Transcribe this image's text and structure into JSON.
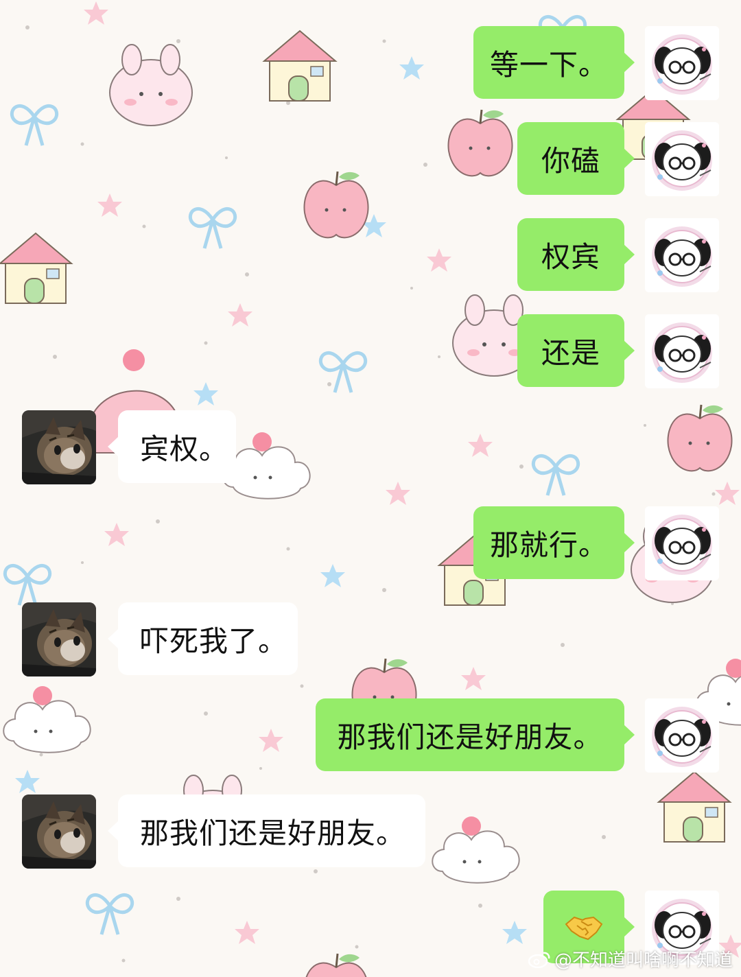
{
  "chat": {
    "messages": [
      {
        "side": "me",
        "text": "等一下。"
      },
      {
        "side": "me",
        "text": "你磕"
      },
      {
        "side": "me",
        "text": "权宾"
      },
      {
        "side": "me",
        "text": "还是"
      },
      {
        "side": "them",
        "text": "宾权。"
      },
      {
        "side": "me",
        "text": "那就行。"
      },
      {
        "side": "them",
        "text": "吓死我了。"
      },
      {
        "side": "me",
        "text": "那我们还是好朋友。"
      },
      {
        "side": "them",
        "text": "那我们还是好朋友。"
      },
      {
        "side": "me",
        "emoji": "handshake-emoji"
      }
    ]
  },
  "colors": {
    "my_bubble": "#95ec69",
    "their_bubble": "#ffffff",
    "background": "#fbf8f4"
  },
  "watermark": {
    "text": "@不知道叫啥啊不知道",
    "icon": "weibo-icon"
  }
}
